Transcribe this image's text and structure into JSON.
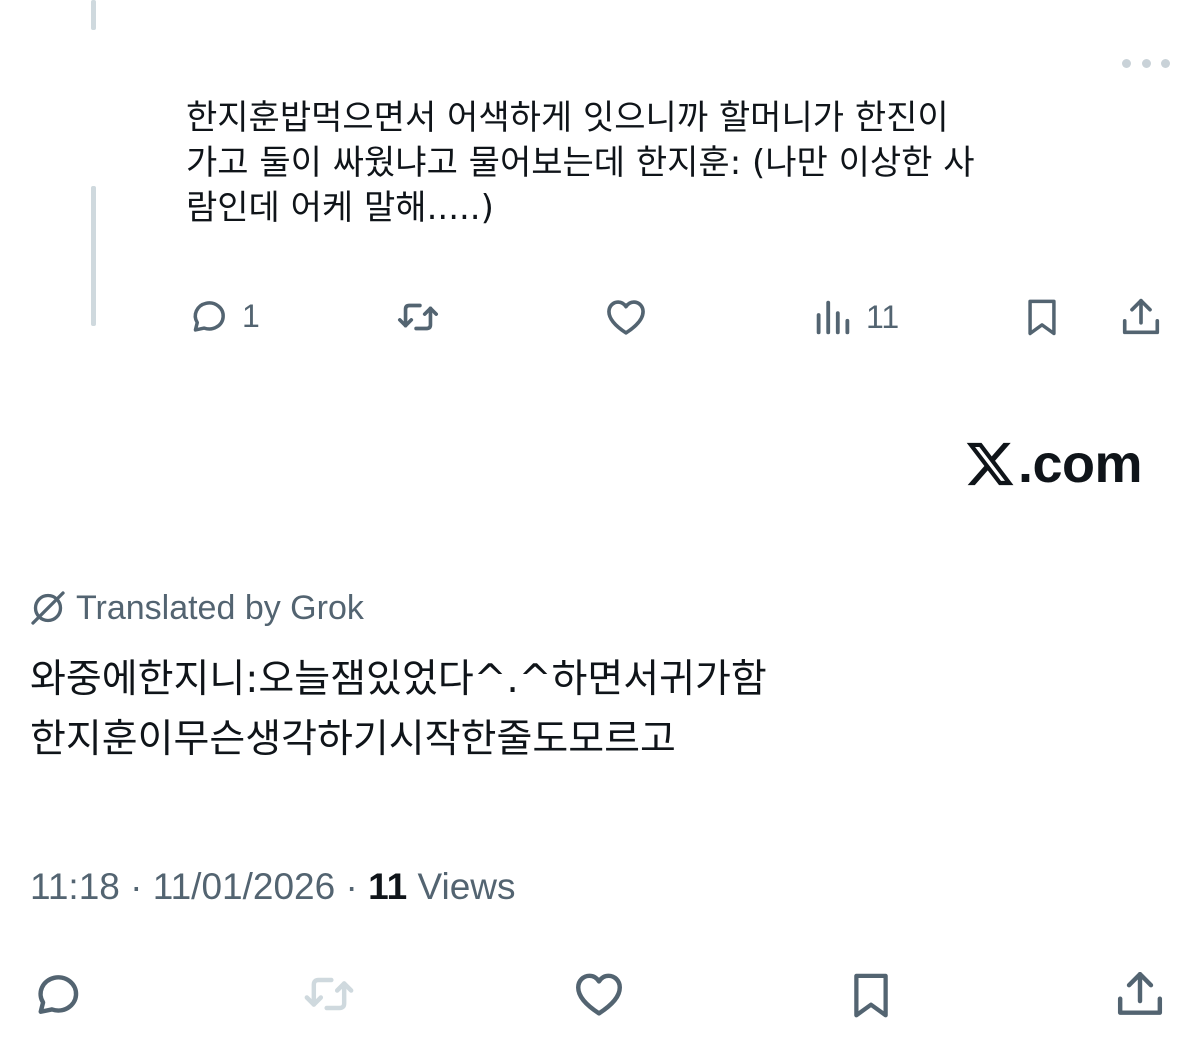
{
  "reply": {
    "text": "한지훈밥먹으면서 어색하게 잇으니까 할머니가 한진이\n가고 둘이 싸웠냐고 물어보는데 한지훈: (나만 이상한 사\n람인데 어케 말해.....)",
    "reply_count": "1",
    "views_count": "11"
  },
  "watermark": {
    "suffix": ".com"
  },
  "translation": {
    "label": "Translated by Grok",
    "lines": [
      "와중에한지니:오늘잼있었다^.^하면서귀가함",
      "한지훈이무슨생각하기시작한줄도모르고"
    ]
  },
  "meta": {
    "time": "11:18",
    "separator1": " · ",
    "date": "11/01/2026",
    "separator2": " · ",
    "views_count": "11",
    "views_label": " Views"
  },
  "icons": {
    "more": "more-horizontal-icon",
    "reply": "speech-bubble-icon",
    "repost": "repost-arrows-icon",
    "like": "heart-icon",
    "views": "bar-chart-icon",
    "bookmark": "bookmark-icon",
    "share": "upload-share-icon",
    "grok": "grok-slash-circle-icon",
    "logo": "x-logo-icon"
  },
  "colors": {
    "text_primary": "#0f1419",
    "text_secondary": "#536471",
    "icon_gray": "#536471",
    "disabled_gray": "#cfd9de",
    "thread_line": "#cfd9de"
  }
}
